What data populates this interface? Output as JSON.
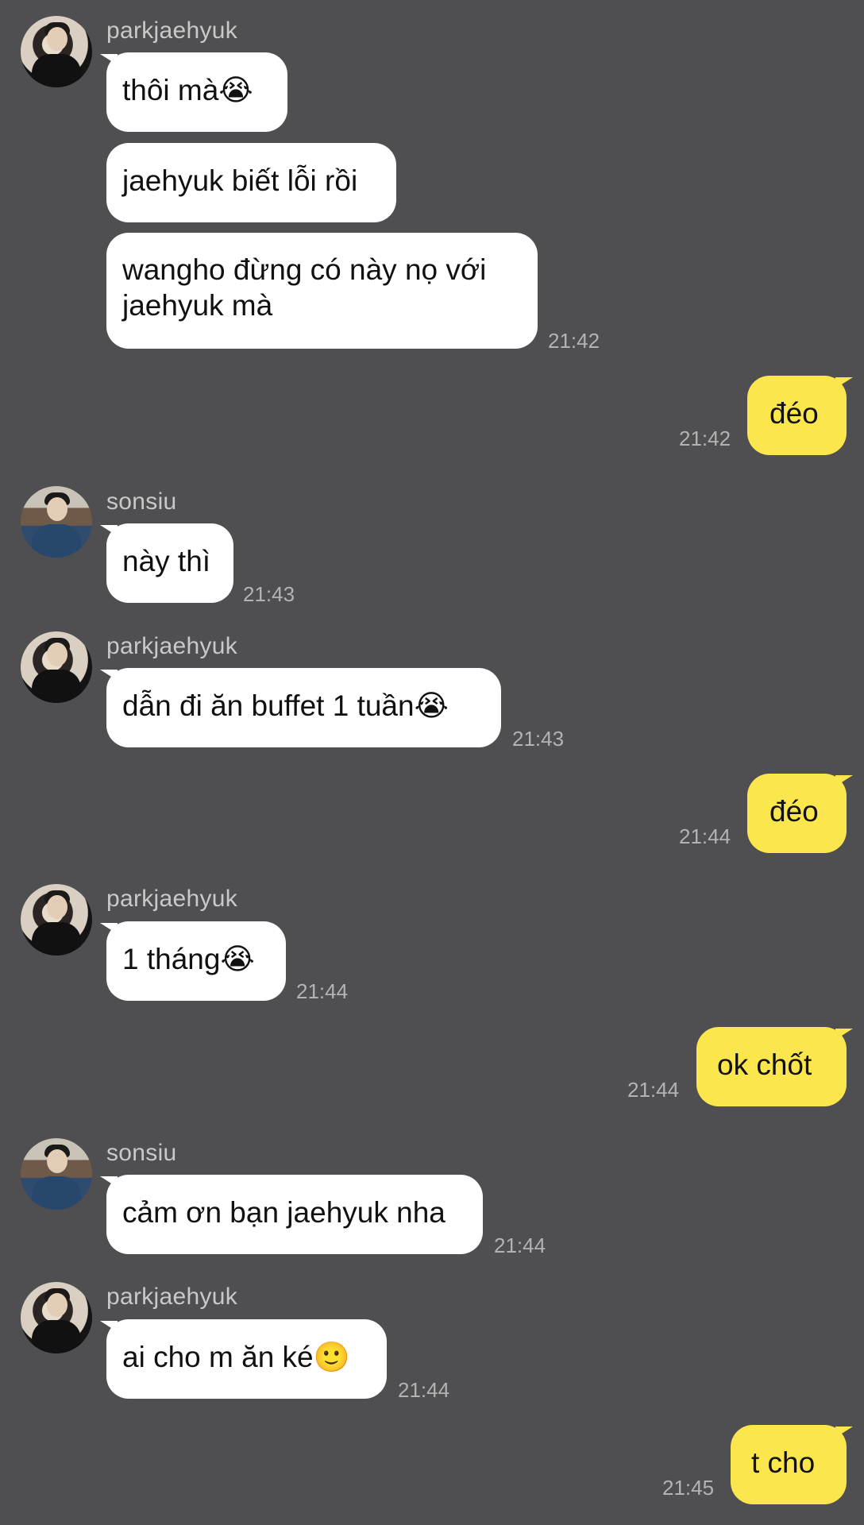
{
  "messages": [
    {
      "sender": "parkjaehyuk",
      "text": "thôi mà😭"
    },
    {
      "text": "jaehyuk biết lỗi rồi"
    },
    {
      "text": "wangho đừng có này nọ với\njaehyuk mà",
      "time": "21:42"
    },
    {
      "mine": true,
      "text": "đéo",
      "time": "21:42"
    },
    {
      "sender": "sonsiu",
      "text": "này thì",
      "time": "21:43"
    },
    {
      "sender": "parkjaehyuk",
      "text": "dẫn đi ăn buffet 1 tuần😭",
      "time": "21:43"
    },
    {
      "mine": true,
      "text": "đéo",
      "time": "21:44"
    },
    {
      "sender": "parkjaehyuk",
      "text": "1 tháng😭",
      "time": "21:44"
    },
    {
      "mine": true,
      "text": "ok chốt",
      "time": "21:44"
    },
    {
      "sender": "sonsiu",
      "text": "cảm ơn bạn jaehyuk nha",
      "time": "21:44"
    },
    {
      "sender": "parkjaehyuk",
      "text": "ai cho m ăn ké🙂",
      "time": "21:44"
    },
    {
      "mine": true,
      "text": "t cho",
      "time": "21:45"
    }
  ]
}
